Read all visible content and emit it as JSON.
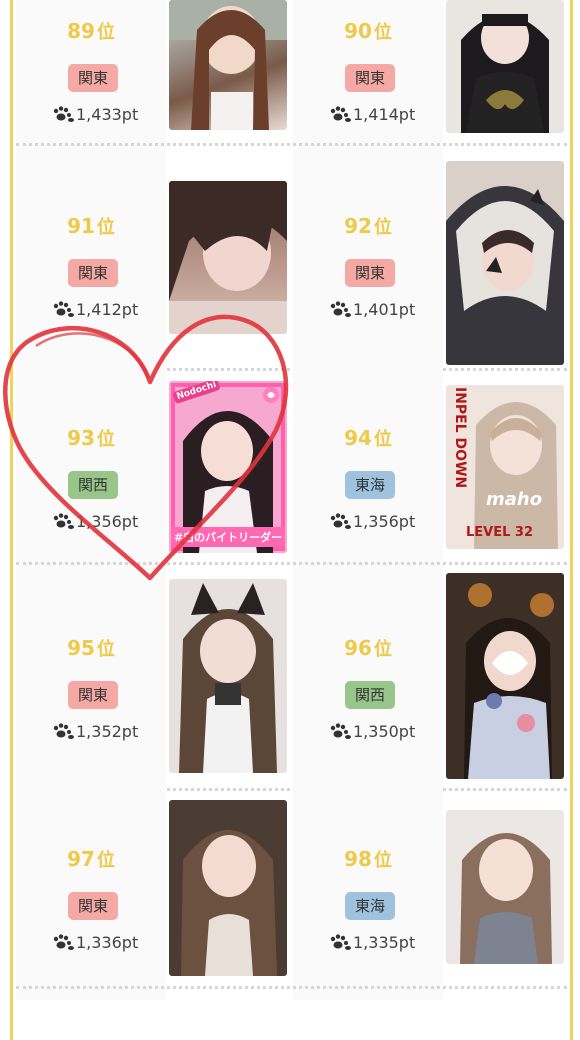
{
  "rankings": [
    {
      "rank": "89",
      "unit": "位",
      "region": "関東",
      "region_class": "kanto",
      "points": "1,433pt"
    },
    {
      "rank": "90",
      "unit": "位",
      "region": "関東",
      "region_class": "kanto",
      "points": "1,414pt"
    },
    {
      "rank": "91",
      "unit": "位",
      "region": "関東",
      "region_class": "kanto",
      "points": "1,412pt"
    },
    {
      "rank": "92",
      "unit": "位",
      "region": "関東",
      "region_class": "kanto",
      "points": "1,401pt"
    },
    {
      "rank": "93",
      "unit": "位",
      "region": "関西",
      "region_class": "kansai",
      "points": "1,356pt"
    },
    {
      "rank": "94",
      "unit": "位",
      "region": "東海",
      "region_class": "tokai",
      "points": "1,356pt"
    },
    {
      "rank": "95",
      "unit": "位",
      "region": "関東",
      "region_class": "kanto",
      "points": "1,352pt"
    },
    {
      "rank": "96",
      "unit": "位",
      "region": "関西",
      "region_class": "kansai",
      "points": "1,350pt"
    },
    {
      "rank": "97",
      "unit": "位",
      "region": "関東",
      "region_class": "kanto",
      "points": "1,336pt"
    },
    {
      "rank": "98",
      "unit": "位",
      "region": "東海",
      "region_class": "tokai",
      "points": "1,335pt"
    }
  ],
  "photo_overlays": {
    "rank93_tag": "#白のバイトリーダー",
    "rank93_sticker": "Nodochi",
    "rank94_title": "INPEL DOWN",
    "rank94_name": "maho",
    "rank94_level": "LEVEL 32"
  },
  "colors": {
    "frame": "#f2d35a",
    "rank_text": "#efc94a",
    "kanto_badge": "#f4a9a4",
    "kansai_badge": "#98c68a",
    "tokai_badge": "#9fc3df",
    "heart_drawing": "#e0333a"
  },
  "icons": {
    "points": "paw-icon"
  }
}
